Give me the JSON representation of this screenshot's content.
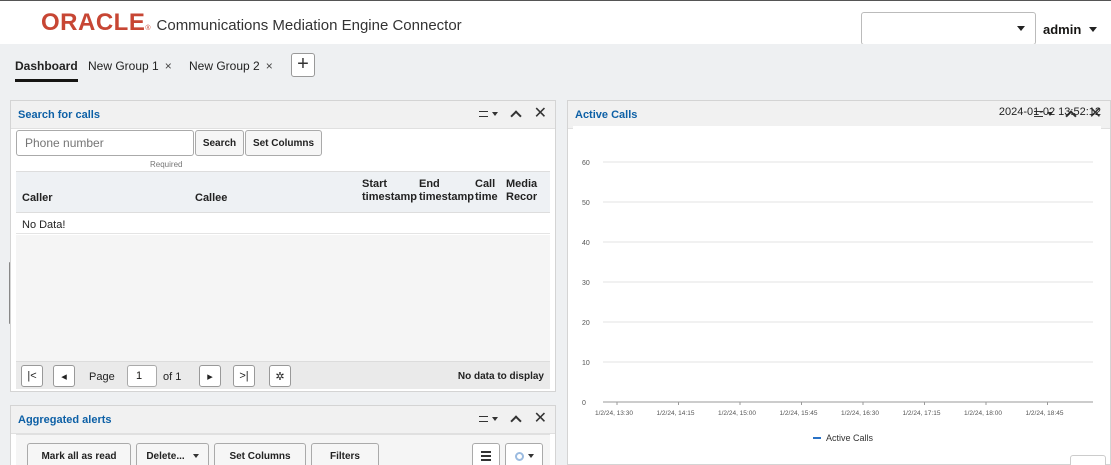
{
  "brand": {
    "logo": "ORACLE",
    "registered": "®",
    "product": "Communications Mediation Engine Connector"
  },
  "header": {
    "select_value": "",
    "user": "admin"
  },
  "tabs": [
    {
      "label": "Dashboard",
      "closable": false,
      "active": true
    },
    {
      "label": "New Group 1",
      "closable": true,
      "active": false
    },
    {
      "label": "New Group 2",
      "closable": true,
      "active": false
    }
  ],
  "tab_close": "×",
  "add_tab": "+",
  "search_panel": {
    "title": "Search for calls",
    "phone_placeholder": "Phone number",
    "required": "Required",
    "search_button": "Search",
    "set_columns_button": "Set Columns",
    "columns": [
      "Caller",
      "Callee",
      "Start timestamp",
      "End timestamp",
      "Call time",
      "Media Recor"
    ],
    "empty_text": "No Data!",
    "pager": {
      "page_label": "Page",
      "page_value": "1",
      "of_label": "of 1",
      "status": "No data to display"
    }
  },
  "alerts_panel": {
    "title": "Aggregated alerts",
    "buttons": {
      "mark_all": "Mark all as read",
      "delete": "Delete...",
      "set_columns": "Set Columns",
      "filters": "Filters"
    }
  },
  "active_calls_panel": {
    "title": "Active Calls",
    "timestamp": "2024-01-02 13:52:12"
  },
  "panel_controls": {
    "close": "✕"
  },
  "colors": {
    "brand_red": "#c74634",
    "title_blue": "#0d60a6",
    "series_blue": "#2a72c6"
  },
  "chart_data": {
    "type": "line",
    "title": "",
    "xlabel": "",
    "ylabel": "",
    "x": [
      "1/2/24, 13:30",
      "1/2/24, 14:15",
      "1/2/24, 15:00",
      "1/2/24, 15:45",
      "1/2/24, 16:30",
      "1/2/24, 17:15",
      "1/2/24, 18:00",
      "1/2/24, 18:45"
    ],
    "yticks": [
      0,
      10,
      20,
      30,
      40,
      50,
      60
    ],
    "ylim": [
      0,
      60
    ],
    "series": [
      {
        "name": "Active Calls",
        "values": []
      }
    ],
    "grid": true,
    "legend": "bottom"
  }
}
